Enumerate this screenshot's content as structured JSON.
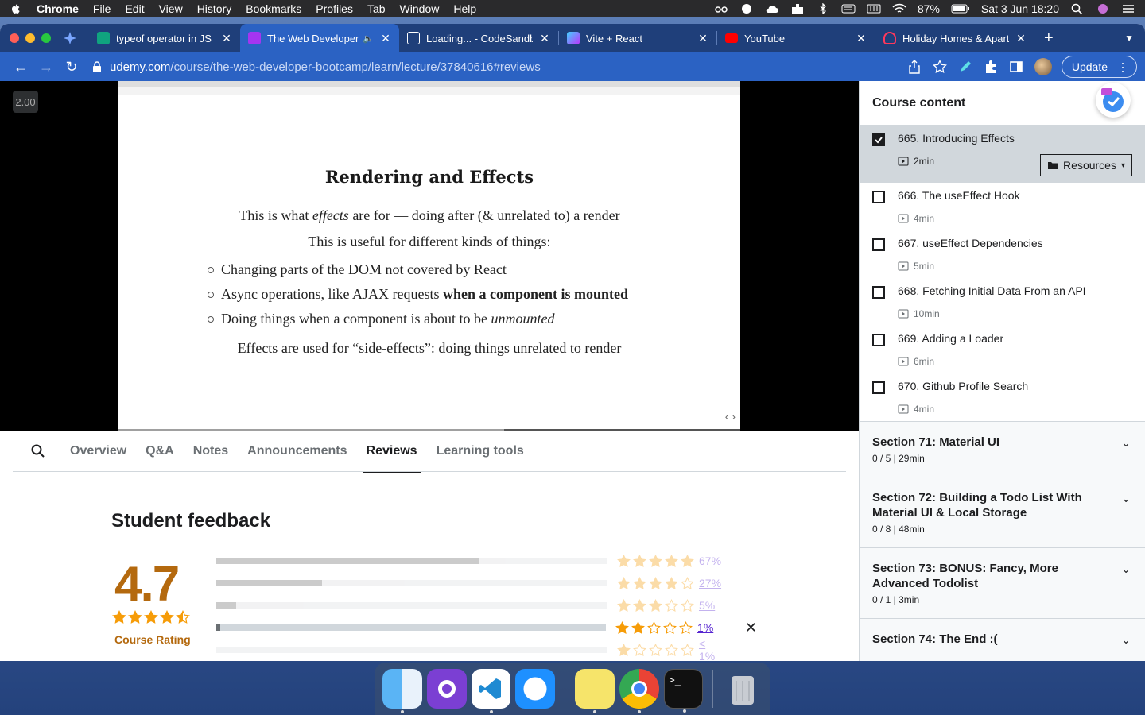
{
  "menubar": {
    "app": "Chrome",
    "items": [
      "File",
      "Edit",
      "View",
      "History",
      "Bookmarks",
      "Profiles",
      "Tab",
      "Window",
      "Help"
    ],
    "battery": "87%",
    "datetime": "Sat 3 Jun  18:20"
  },
  "tabs": [
    {
      "title": "typeof operator in JS",
      "color": "#10a37f"
    },
    {
      "title": "The Web Developer",
      "color": "#a435f0"
    },
    {
      "title": "Loading... - CodeSandb",
      "color": "#ffffff"
    },
    {
      "title": "Vite + React",
      "color": "#bd34fe"
    },
    {
      "title": "YouTube",
      "color": "#ff0000"
    },
    {
      "title": "Holiday Homes & Apartn",
      "color": "#ff385c"
    }
  ],
  "address": {
    "host": "udemy.com",
    "path": "/course/the-web-developer-bootcamp/learn/lecture/37840616#reviews"
  },
  "update_label": "Update",
  "player": {
    "speed": "2.00",
    "progress": 0.62,
    "slide": {
      "title": "Rendering and Effects",
      "line1_pre": "This is what ",
      "line1_em": "effects",
      "line1_post": " are for — doing after (& unrelated to) a render",
      "line2": "This is useful for different kinds of things:",
      "bullet1": "Changing parts of the DOM not covered by React",
      "bullet2_pre": "Async operations, like AJAX requests ",
      "bullet2_bold": "when a component is mounted",
      "bullet3_pre": "Doing things when a component is about to be ",
      "bullet3_em": "unmounted",
      "line3": "Effects are used for “side-effects”: doing things unrelated to render"
    }
  },
  "lecture_tabs": [
    "Overview",
    "Q&A",
    "Notes",
    "Announcements",
    "Reviews",
    "Learning tools"
  ],
  "feedback": {
    "title": "Student feedback",
    "rating": "4.7",
    "rating_value": 4.7,
    "rating_label": "Course Rating",
    "rows": [
      {
        "stars": 5,
        "pct_label": "67%",
        "pct": 67
      },
      {
        "stars": 4,
        "pct_label": "27%",
        "pct": 27
      },
      {
        "stars": 3,
        "pct_label": "5%",
        "pct": 5
      },
      {
        "stars": 2,
        "pct_label": "1%",
        "pct": 1
      },
      {
        "stars": 1,
        "pct_label": "< 1%",
        "pct": 0
      }
    ]
  },
  "sidebar": {
    "title": "Course content",
    "lectures": [
      {
        "title": "665. Introducing Effects",
        "duration": "2min",
        "checked": true
      },
      {
        "title": "666. The useEffect Hook",
        "duration": "4min",
        "checked": false
      },
      {
        "title": "667. useEffect Dependencies",
        "duration": "5min",
        "checked": false
      },
      {
        "title": "668. Fetching Initial Data From an API",
        "duration": "10min",
        "checked": false
      },
      {
        "title": "669. Adding a Loader",
        "duration": "6min",
        "checked": false
      },
      {
        "title": "670. Github Profile Search",
        "duration": "4min",
        "checked": false
      }
    ],
    "resources_label": "Resources",
    "sections": [
      {
        "title": "Section 71: Material UI",
        "meta": "0 / 5 | 29min"
      },
      {
        "title": "Section 72: Building a Todo List With Material UI & Local Storage",
        "meta": "0 / 8 | 48min"
      },
      {
        "title": "Section 73: BONUS: Fancy, More Advanced Todolist",
        "meta": "0 / 1 | 3min"
      },
      {
        "title": "Section 74: The End :(",
        "meta": ""
      }
    ]
  },
  "colors": {
    "accent": "#2b62c3",
    "rating": "#b4690e",
    "star": "#f69c08",
    "link": "#5624d0"
  }
}
